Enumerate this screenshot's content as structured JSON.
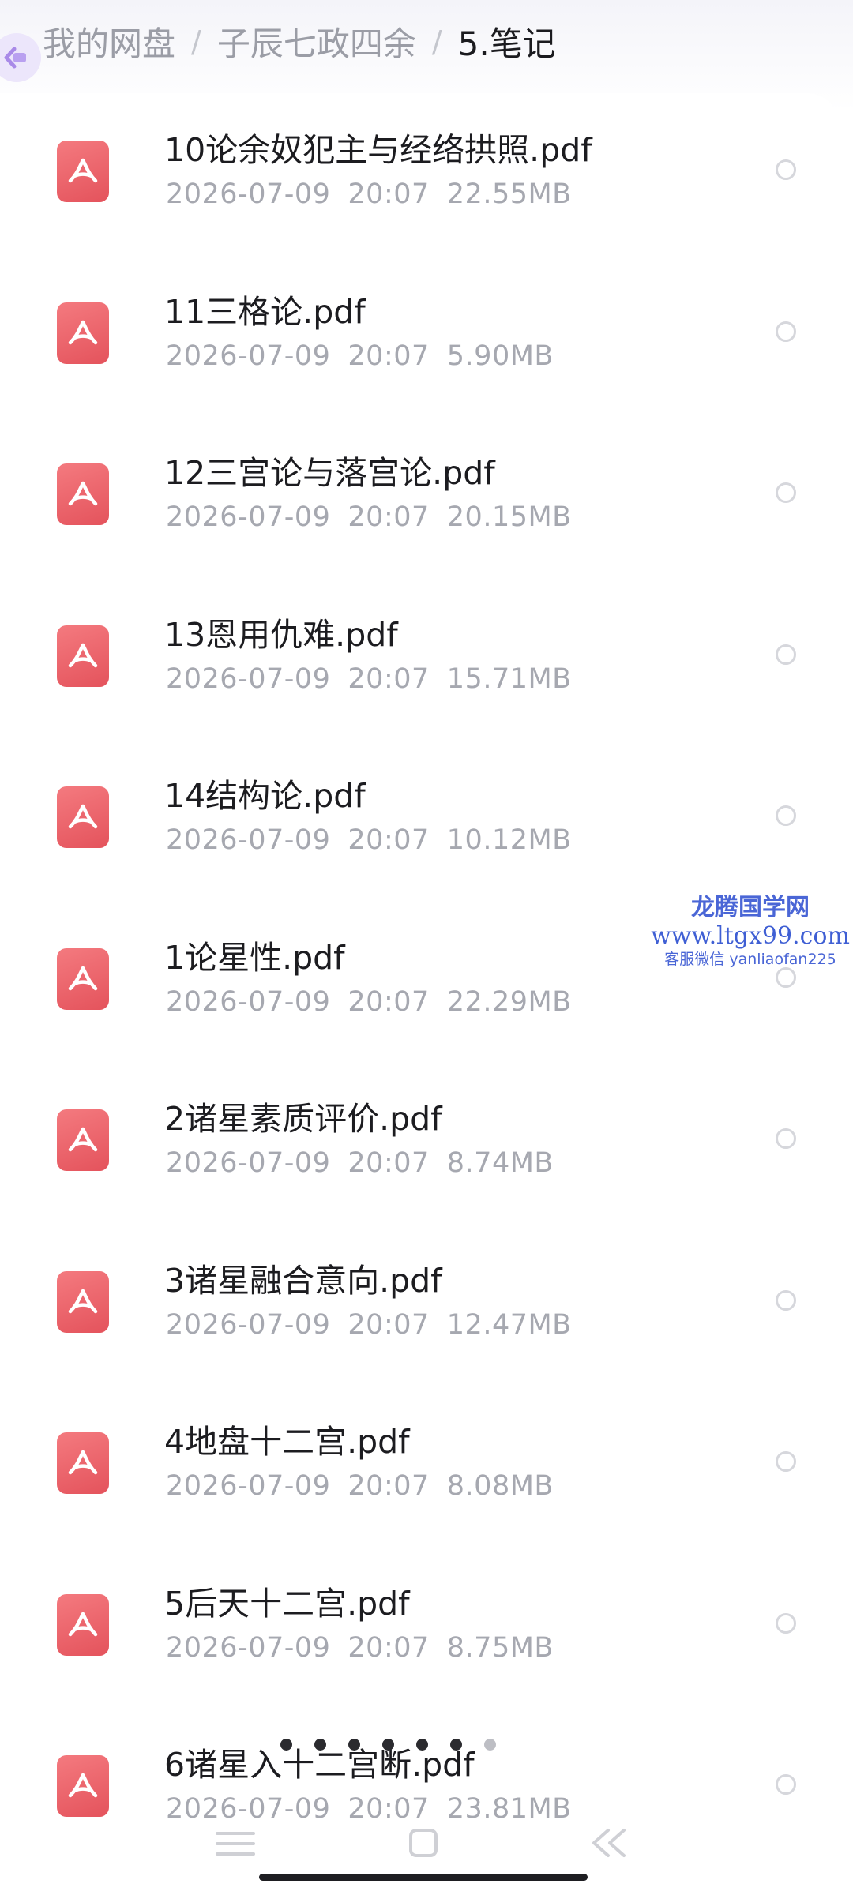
{
  "breadcrumb": [
    {
      "label": "我的网盘"
    },
    {
      "label": "子辰七政四余"
    },
    {
      "label": "5.笔记"
    }
  ],
  "files": [
    {
      "name": "10论余奴犯主与经络拱照.pdf",
      "date": "2026-07-09",
      "time": "20:07",
      "size": "22.55MB"
    },
    {
      "name": "11三格论.pdf",
      "date": "2026-07-09",
      "time": "20:07",
      "size": "5.90MB"
    },
    {
      "name": "12三宫论与落宫论.pdf",
      "date": "2026-07-09",
      "time": "20:07",
      "size": "20.15MB"
    },
    {
      "name": "13恩用仇难.pdf",
      "date": "2026-07-09",
      "time": "20:07",
      "size": "15.71MB"
    },
    {
      "name": "14结构论.pdf",
      "date": "2026-07-09",
      "time": "20:07",
      "size": "10.12MB"
    },
    {
      "name": "1论星性.pdf",
      "date": "2026-07-09",
      "time": "20:07",
      "size": "22.29MB"
    },
    {
      "name": "2诸星素质评价.pdf",
      "date": "2026-07-09",
      "time": "20:07",
      "size": "8.74MB"
    },
    {
      "name": "3诸星融合意向.pdf",
      "date": "2026-07-09",
      "time": "20:07",
      "size": "12.47MB"
    },
    {
      "name": "4地盘十二宫.pdf",
      "date": "2026-07-09",
      "time": "20:07",
      "size": "8.08MB"
    },
    {
      "name": "5后天十二宫.pdf",
      "date": "2026-07-09",
      "time": "20:07",
      "size": "8.75MB"
    },
    {
      "name": "6诸星入十二宫断.pdf",
      "date": "2026-07-09",
      "time": "20:07",
      "size": "23.81MB"
    }
  ],
  "watermark": {
    "title": "龙腾国学网",
    "url": "www.ltgx99.com",
    "contact": "客服微信 yanliaofan225"
  },
  "icons": {
    "file": "pdf-icon",
    "select": "radio-circle-icon",
    "back": "back-arrow-icon",
    "nav": [
      "menu-icon",
      "home-icon",
      "back-icon"
    ]
  },
  "colors": {
    "pdf_icon": "#e4535c",
    "watermark": "#4a66d6",
    "secondary_text": "#a6a8b0"
  },
  "page_indicator": {
    "count": 7,
    "active": 6
  }
}
